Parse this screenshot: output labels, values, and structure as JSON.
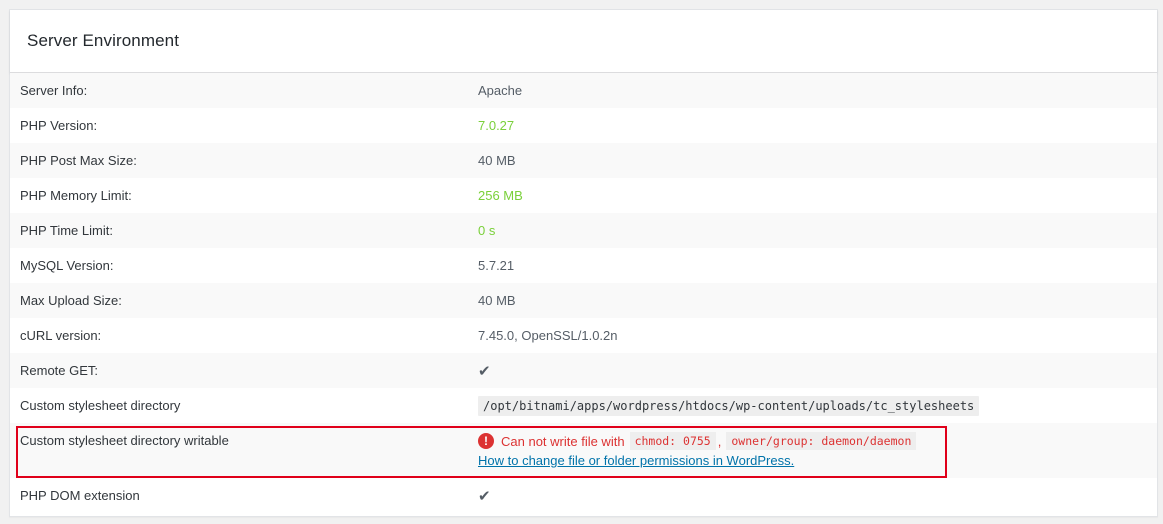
{
  "panel": {
    "title": "Server Environment"
  },
  "rows": [
    {
      "label": "Server Info:",
      "value": "Apache"
    },
    {
      "label": "PHP Version:",
      "value": "7.0.27"
    },
    {
      "label": "PHP Post Max Size:",
      "value": "40 MB"
    },
    {
      "label": "PHP Memory Limit:",
      "value": "256 MB"
    },
    {
      "label": "PHP Time Limit:",
      "value": "0 s"
    },
    {
      "label": "MySQL Version:",
      "value": "5.7.21"
    },
    {
      "label": "Max Upload Size:",
      "value": "40 MB"
    },
    {
      "label": "cURL version:",
      "value": "7.45.0, OpenSSL/1.0.2n"
    },
    {
      "label": "Remote GET:",
      "value": "✔"
    },
    {
      "label": "Custom stylesheet directory",
      "value": "/opt/bitnami/apps/wordpress/htdocs/wp-content/uploads/tc_stylesheets"
    },
    {
      "label": "Custom stylesheet directory writable",
      "error_text": "Can not write file with",
      "chmod_code": "chmod: 0755",
      "separator": ",",
      "owner_code": "owner/group: daemon/daemon",
      "link_text": "How to change file or folder permissions in WordPress."
    },
    {
      "label": "PHP DOM extension",
      "value": "✔"
    }
  ],
  "colors": {
    "ok_green": "#7ad03a",
    "error_red": "#dc3232",
    "link_blue": "#0073aa",
    "highlight_red": "#e0001a"
  }
}
